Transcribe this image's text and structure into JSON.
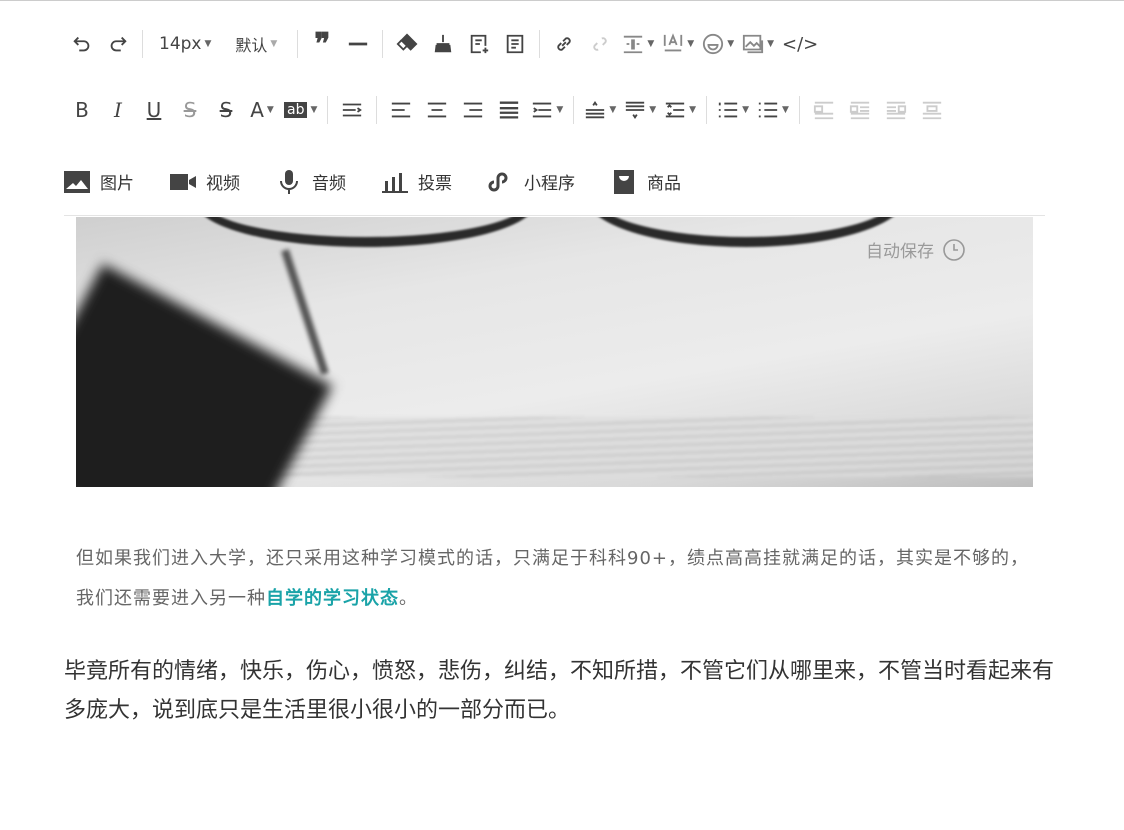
{
  "toolbar": {
    "font_size": "14px",
    "font_family": "默认"
  },
  "media": {
    "items": [
      {
        "label": "图片"
      },
      {
        "label": "视频"
      },
      {
        "label": "音频"
      },
      {
        "label": "投票"
      },
      {
        "label": "小程序"
      },
      {
        "label": "商品"
      }
    ]
  },
  "autosave": {
    "label": "自动保存"
  },
  "content": {
    "caption_text": "但如果我们进入大学，还只采用这种学习模式的话，只满足于科科90+，绩点高高挂就满足的话，其实是不够的，我们还需要进入另一种",
    "caption_highlight": "自学的学习状态",
    "caption_end": "。",
    "highlight_color": "#1aa3a8",
    "main_text": "毕竟所有的情绪，快乐，伤心，愤怒，悲伤，纠结，不知所措，不管它们从哪里来，不管当时看起来有多庞大，说到底只是生活里很小很小的一部分而已。"
  }
}
